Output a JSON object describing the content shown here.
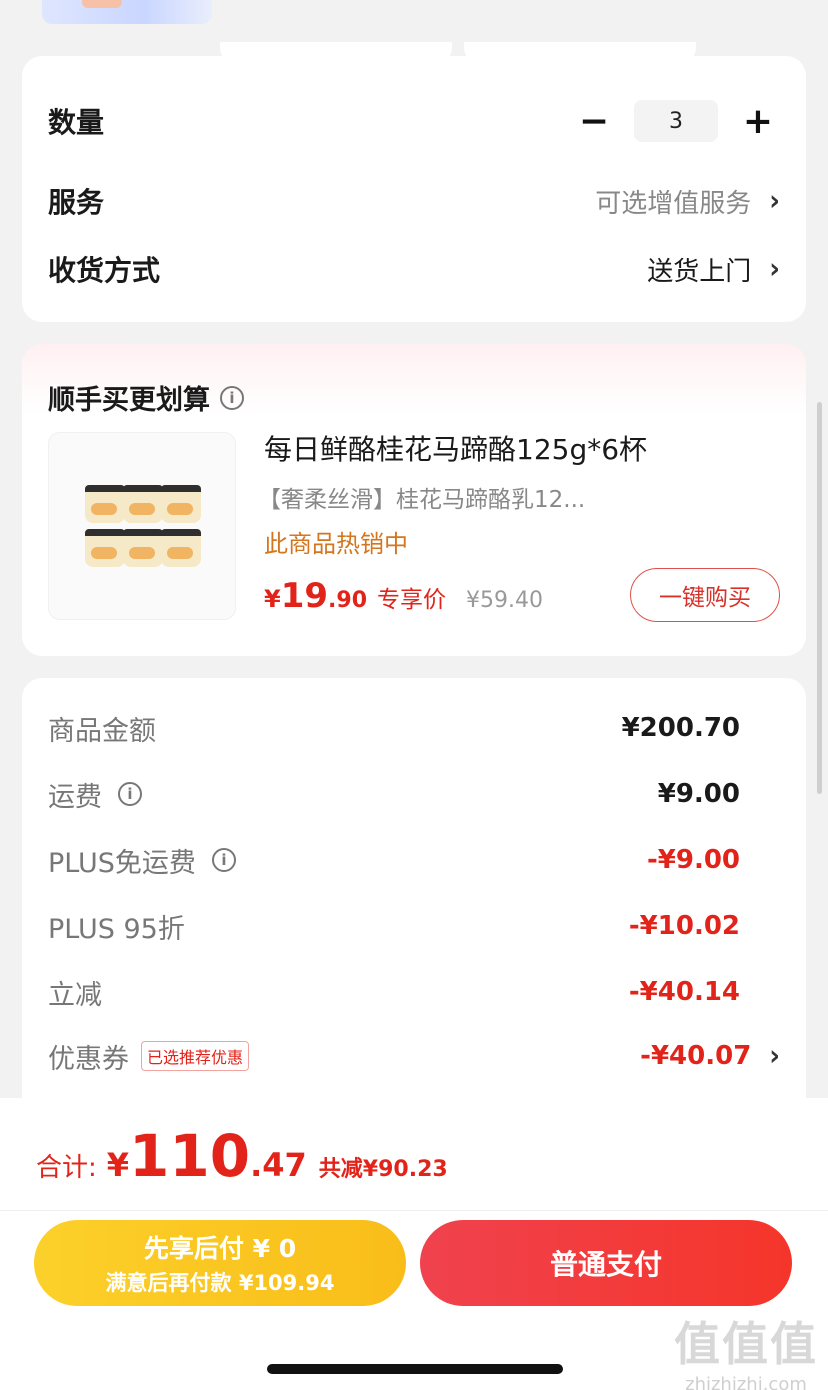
{
  "order_options": {
    "quantity_label": "数量",
    "quantity_value": "3",
    "minus_symbol": "−",
    "plus_symbol": "+",
    "service_label": "服务",
    "service_value": "可选增值服务",
    "delivery_label": "收货方式",
    "delivery_value": "送货上门",
    "chevron": "›"
  },
  "recommend": {
    "title": "顺手买更划算",
    "product_name": "每日鲜酪桂花马蹄酪125g*6杯",
    "product_subtitle": "【奢柔丝滑】桂花马蹄酪乳12...",
    "hot_text": "此商品热销中",
    "price_symbol": "¥",
    "price_int": "19",
    "price_dec": ".90",
    "price_tag": "专享价",
    "old_price": "¥59.40",
    "buy_button": "一键购买"
  },
  "summary": {
    "rows": [
      {
        "label": "商品金额",
        "value": "¥200.70"
      },
      {
        "label": "运费",
        "value": "¥9.00"
      },
      {
        "label": "PLUS免运费",
        "value": "-¥9.00"
      },
      {
        "label": "PLUS 95折",
        "value": "-¥10.02"
      },
      {
        "label": "立减",
        "value": "-¥40.14"
      },
      {
        "label": "优惠券",
        "value": "-¥40.07",
        "tag": "已选推荐优惠"
      }
    ],
    "info_glyph": "i"
  },
  "footer": {
    "total_label": "合计:",
    "total_symbol": "¥",
    "total_int": "110",
    "total_dec": ".47",
    "total_saved": "共减¥90.23",
    "pay_later_line1": "先享后付 ¥ 0",
    "pay_later_line2": "满意后再付款 ¥109.94",
    "pay_normal": "普通支付"
  },
  "watermark": {
    "big": "值值值",
    "small": "zhizhizhi.com"
  },
  "colors": {
    "accent_red": "#e2231a",
    "pay_later_yellow": "#fcd02a",
    "hot_orange": "#d4761e"
  }
}
